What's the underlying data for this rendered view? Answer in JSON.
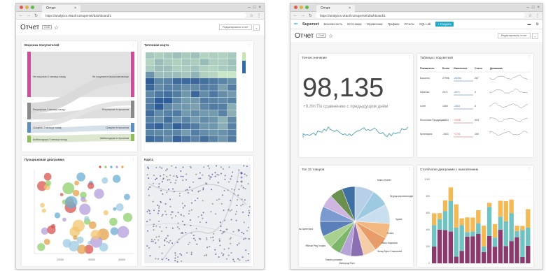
{
  "browser": {
    "tab_title": "Отчет",
    "url": "https://analytics.vkaoll.ru/superset/dashboard/1"
  },
  "left_window": {
    "dashboard": {
      "title": "Отчет",
      "badge": "Draft",
      "edit_label": "Редактировать отчет"
    },
    "charts": {
      "sankey_title": "Воронка покупателей",
      "heatmap_title": "Тепловая карта",
      "bubble_title": "Пузырьковая диаграмма",
      "map_title": "Карта"
    },
    "sankey_labels": {
      "left": [
        "Не покупали 2 месяца назад",
        "Регулярные 2 месяца назад",
        "Средние 2 месяца назад",
        "Амбассадоры 2 месяца назад"
      ],
      "right": [
        "Не покупали в прошлом месяце",
        "Регулярные в прошлом",
        "Средние в прошлом",
        "Амбассадоры в прошлом"
      ]
    },
    "bubble_axis": {
      "x_ticks": [
        "20000",
        "30000",
        "40000"
      ]
    }
  },
  "right_window": {
    "navbar": {
      "brand": "Superset",
      "items": [
        "Безопасность",
        "Источники",
        "Управление",
        "Графики",
        "Отчеты",
        "SQL Lab"
      ],
      "new_button": "+ Создать"
    },
    "dashboard": {
      "title": "Отчет",
      "badge": "Draft",
      "edit_label": "Редактировать отчет"
    },
    "big_number": {
      "title": "Точное значение",
      "value": "98,135",
      "subtitle": "+9.3% По сравнению с предыдущим днём"
    },
    "table": {
      "title": "Таблица с подсветкой",
      "headers": [
        "Показатель",
        "Было",
        "Изменение",
        "Стало",
        "Динамика"
      ],
      "rows": [
        {
          "name": "Бакалея",
          "was": "27996",
          "change": "-26784",
          "now": "267"
        },
        {
          "name": "Напитки",
          "was": "2071",
          "change": "-2071",
          "now": "0"
        },
        {
          "name": "Хлеб",
          "was": "1060",
          "change": "-1003",
          "now": "0"
        },
        {
          "name": "Молочная Продукция",
          "was": "-1404",
          "change": "+2008",
          "now": "604"
        },
        {
          "name": "Кулинария",
          "was": "-1541",
          "change": "+1701",
          "now": "160"
        }
      ]
    },
    "pie": {
      "title": "Топ 15 товаров",
      "labels": [
        "Манго Египет",
        "Огурцы короткоплодные",
        "Хурма",
        "Семга",
        "Мясо Нарезное",
        "Эклер Мусс Сливочный",
        "Виноград Ролл",
        "Томаты розовые",
        "Яблоки Ред Глория",
        "Лимоны Аргентина"
      ]
    },
    "stacked": {
      "title": "Столбчатая диаграмма с накоплением",
      "y_ticks": [
        "1000",
        "800",
        "600",
        "400",
        "200",
        "0"
      ]
    }
  }
}
